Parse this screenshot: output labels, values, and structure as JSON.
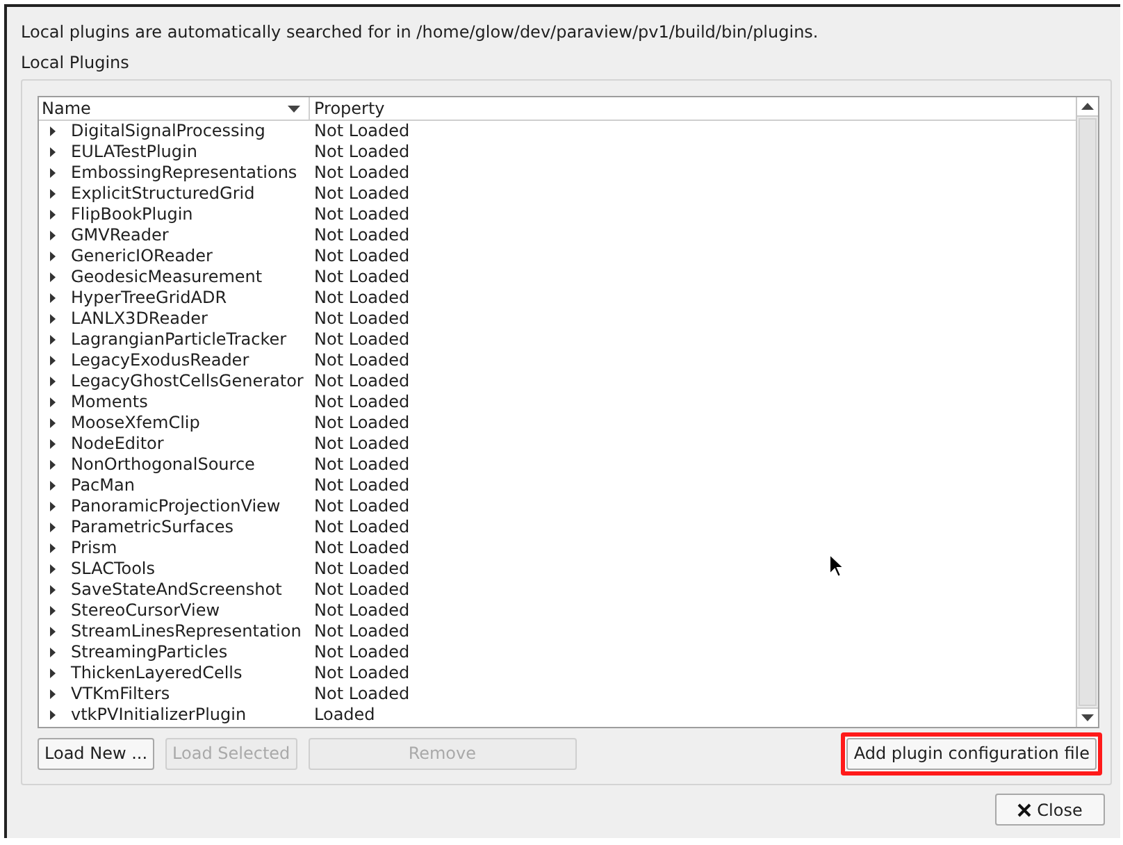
{
  "info_text": "Local plugins are automatically searched for in /home/glow/dev/paraview/pv1/build/bin/plugins.",
  "group_title": "Local Plugins",
  "table": {
    "columns": [
      {
        "label": "Name",
        "sorted": true
      },
      {
        "label": "Property",
        "sorted": false
      }
    ],
    "rows": [
      {
        "name": "DigitalSignalProcessing",
        "property": "Not Loaded",
        "expanded": false
      },
      {
        "name": "EULATestPlugin",
        "property": "Not Loaded",
        "expanded": false
      },
      {
        "name": "EmbossingRepresentations",
        "property": "Not Loaded",
        "expanded": false
      },
      {
        "name": "ExplicitStructuredGrid",
        "property": "Not Loaded",
        "expanded": false
      },
      {
        "name": "FlipBookPlugin",
        "property": "Not Loaded",
        "expanded": false
      },
      {
        "name": "GMVReader",
        "property": "Not Loaded",
        "expanded": false
      },
      {
        "name": "GenericIOReader",
        "property": "Not Loaded",
        "expanded": false
      },
      {
        "name": "GeodesicMeasurement",
        "property": "Not Loaded",
        "expanded": false
      },
      {
        "name": "HyperTreeGridADR",
        "property": "Not Loaded",
        "expanded": false
      },
      {
        "name": "LANLX3DReader",
        "property": "Not Loaded",
        "expanded": false
      },
      {
        "name": "LagrangianParticleTracker",
        "property": "Not Loaded",
        "expanded": false
      },
      {
        "name": "LegacyExodusReader",
        "property": "Not Loaded",
        "expanded": false
      },
      {
        "name": "LegacyGhostCellsGenerator",
        "property": "Not Loaded",
        "expanded": false
      },
      {
        "name": "Moments",
        "property": "Not Loaded",
        "expanded": false
      },
      {
        "name": "MooseXfemClip",
        "property": "Not Loaded",
        "expanded": false
      },
      {
        "name": "NodeEditor",
        "property": "Not Loaded",
        "expanded": false
      },
      {
        "name": "NonOrthogonalSource",
        "property": "Not Loaded",
        "expanded": false
      },
      {
        "name": "PacMan",
        "property": "Not Loaded",
        "expanded": false
      },
      {
        "name": "PanoramicProjectionView",
        "property": "Not Loaded",
        "expanded": false
      },
      {
        "name": "ParametricSurfaces",
        "property": "Not Loaded",
        "expanded": false
      },
      {
        "name": "Prism",
        "property": "Not Loaded",
        "expanded": false
      },
      {
        "name": "SLACTools",
        "property": "Not Loaded",
        "expanded": false
      },
      {
        "name": "SaveStateAndScreenshot",
        "property": "Not Loaded",
        "expanded": false
      },
      {
        "name": "StereoCursorView",
        "property": "Not Loaded",
        "expanded": false
      },
      {
        "name": "StreamLinesRepresentation",
        "property": "Not Loaded",
        "expanded": false
      },
      {
        "name": "StreamingParticles",
        "property": "Not Loaded",
        "expanded": false
      },
      {
        "name": "ThickenLayeredCells",
        "property": "Not Loaded",
        "expanded": false
      },
      {
        "name": "VTKmFilters",
        "property": "Not Loaded",
        "expanded": false
      },
      {
        "name": "vtkPVInitializerPlugin",
        "property": "Loaded",
        "expanded": false
      }
    ]
  },
  "buttons": [
    {
      "label": "Load New ...",
      "disabled": false,
      "kind": "compact"
    },
    {
      "label": "Load Selected",
      "disabled": true,
      "kind": "compact"
    },
    {
      "label": "Remove",
      "disabled": true,
      "kind": "wide"
    },
    {
      "label": "Add plugin configuration file",
      "disabled": false,
      "highlighted": true,
      "kind": "right"
    }
  ],
  "close_button": {
    "label": "Close"
  }
}
